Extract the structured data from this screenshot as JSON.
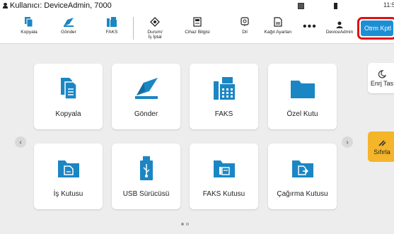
{
  "status": {
    "user_text": "Kullanıcı: DeviceAdmin, 7000",
    "time": "11:5"
  },
  "toolbar": {
    "items": [
      {
        "label": "Kopyala",
        "icon": "copy-icon"
      },
      {
        "label": "Gönder",
        "icon": "send-icon"
      },
      {
        "label": "FAKS",
        "icon": "fax-icon"
      },
      {
        "label": "Durum/\nİş İptal",
        "icon": "status-icon"
      },
      {
        "label": "Cihaz Bilgisi",
        "icon": "device-info-icon"
      },
      {
        "label": "Dil",
        "icon": "language-icon"
      },
      {
        "label": "Kağıt Ayarları",
        "icon": "paper-settings-icon"
      },
      {
        "label": "DeviceAdmin",
        "icon": "user-icon"
      }
    ],
    "more": "•••",
    "otrm_label": "Otrm Kptl"
  },
  "tiles": [
    {
      "label": "Kopyala",
      "icon": "copy-icon"
    },
    {
      "label": "Gönder",
      "icon": "send-icon"
    },
    {
      "label": "FAKS",
      "icon": "fax-icon"
    },
    {
      "label": "Özel Kutu",
      "icon": "custom-box-icon"
    },
    {
      "label": "İş Kutusu",
      "icon": "job-box-icon"
    },
    {
      "label": "USB Sürücüsü",
      "icon": "usb-drive-icon"
    },
    {
      "label": "FAKS Kutusu",
      "icon": "fax-box-icon"
    },
    {
      "label": "Çağırma Kutusu",
      "icon": "polling-box-icon"
    }
  ],
  "side": {
    "energy_label": "Enrj Tas",
    "reset_label": "Sıfırla"
  },
  "nav": {
    "prev": "‹",
    "next": "›"
  },
  "colors": {
    "accent": "#1b8fd6",
    "highlight": "#e11010",
    "reset": "#f4b52a",
    "icon_teal": "#1b86c4"
  }
}
